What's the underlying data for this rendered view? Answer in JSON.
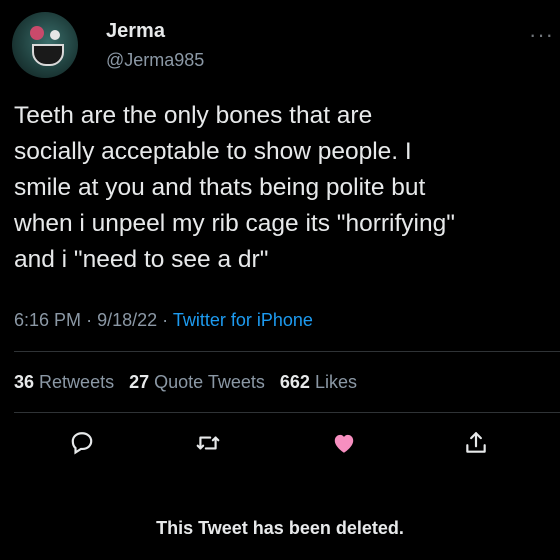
{
  "author": {
    "name": "Jerma",
    "handle": "@Jerma985"
  },
  "tweet": {
    "text": "Teeth are the only bones that are\nsocially acceptable to show people. I\nsmile at you and thats being polite but\nwhen i unpeel my rib cage its \"horrifying\"\nand i \"need to see a dr\"",
    "time": "6:16 PM",
    "date": "9/18/22",
    "source": "Twitter for iPhone"
  },
  "stats": {
    "retweets_count": "36",
    "retweets_label": "Retweets",
    "quote_count": "27",
    "quote_label": "Quote Tweets",
    "likes_count": "662",
    "likes_label": "Likes"
  },
  "actions": [
    "reply-icon",
    "retweet-icon",
    "like-icon",
    "share-icon"
  ],
  "colors": {
    "background": "#000000",
    "text": "#e7e9ea",
    "secondary": "#8b98a5",
    "link": "#1d9bf0",
    "like": "#f91880"
  },
  "notice": "This Tweet has been deleted."
}
